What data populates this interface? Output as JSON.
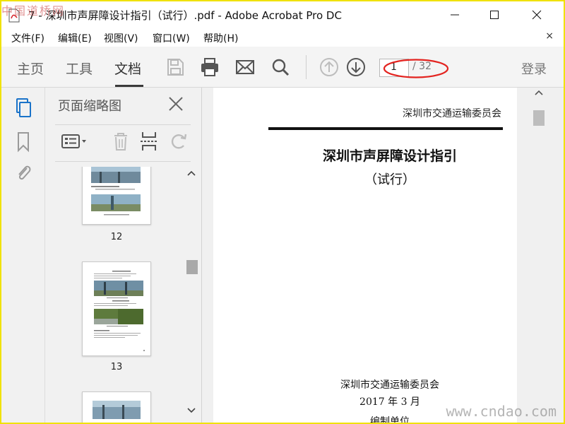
{
  "watermark": {
    "top": "中国道桥网",
    "bottom": "www.cndao.com"
  },
  "window": {
    "title": "7 - 深圳市声屏障设计指引（试行）.pdf - Adobe Acrobat Pro DC"
  },
  "menu": {
    "items": [
      "文件(F)",
      "编辑(E)",
      "视图(V)",
      "窗口(W)",
      "帮助(H)"
    ],
    "close": "×"
  },
  "toolbar": {
    "tabs": [
      "主页",
      "工具",
      "文档"
    ],
    "active_tab": "文档",
    "page_current": "1",
    "page_total": "/ 32",
    "login": "登录",
    "icons": [
      "save-icon",
      "print-icon",
      "mail-icon",
      "search-icon",
      "page-up-icon",
      "page-down-icon"
    ],
    "highlight_color": "#e3231f"
  },
  "panel": {
    "title": "页面缩略图",
    "thumbnails": [
      {
        "label": "12"
      },
      {
        "label": "13"
      },
      {
        "label": ""
      }
    ]
  },
  "document": {
    "header": "深圳市交通运输委员会",
    "title": "深圳市声屏障设计指引",
    "subtitle": "（试行）",
    "issuer": "深圳市交通运输委员会",
    "date": "2017 年 3 月",
    "cut_line": "编制单位"
  }
}
